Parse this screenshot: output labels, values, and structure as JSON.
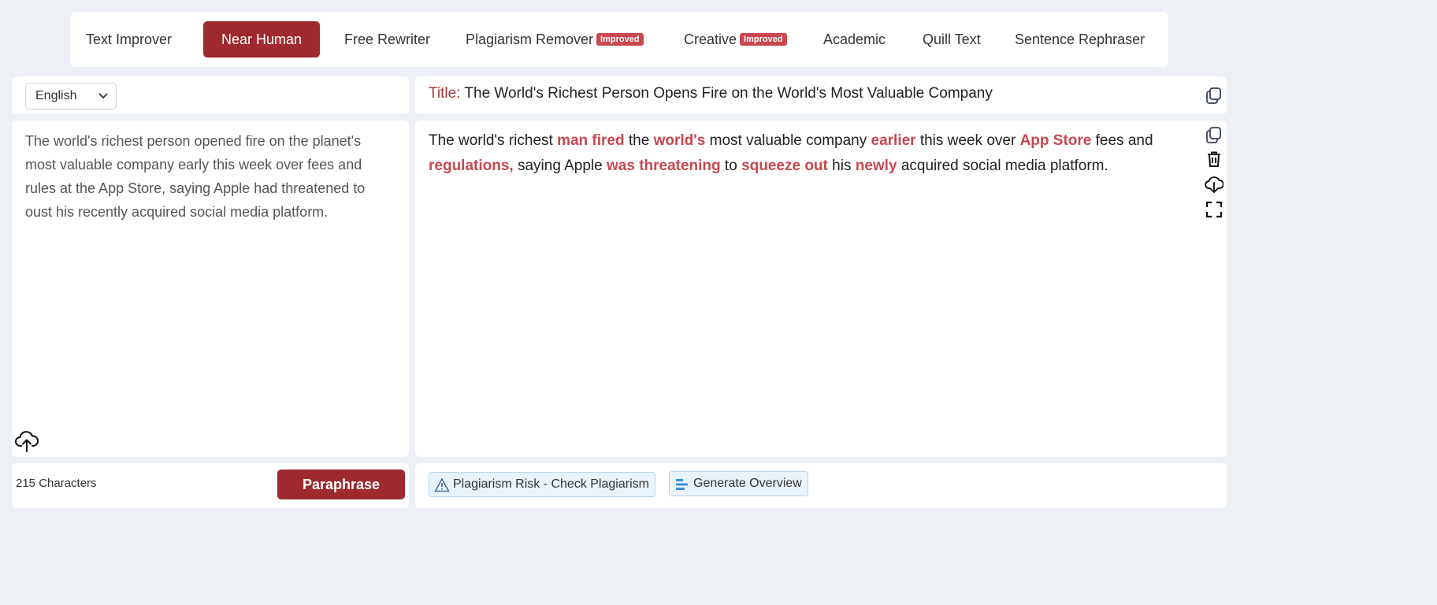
{
  "modes": [
    {
      "label": "Text Improver",
      "active": false
    },
    {
      "label": "Near Human",
      "active": true
    },
    {
      "label": "Free Rewriter",
      "active": false
    },
    {
      "label": "Plagiarism Remover",
      "active": false,
      "badge": "Improved"
    },
    {
      "label": "Creative",
      "active": false,
      "badge": "Improved"
    },
    {
      "label": "Academic",
      "active": false
    },
    {
      "label": "Quill Text",
      "active": false
    },
    {
      "label": "Sentence Rephraser",
      "active": false
    }
  ],
  "language": {
    "selected": "English"
  },
  "input": {
    "text": "The world's richest person opened fire on the planet's most valuable company early this week over fees and rules at the App Store, saying Apple had threatened to oust his recently acquired social media platform.",
    "char_count": "215 Characters",
    "paraphrase_label": "Paraphrase"
  },
  "output": {
    "title_label": "Title:",
    "title_text": "The World's Richest Person Opens Fire on the World's Most Valuable Company",
    "segments": [
      {
        "t": "The world's richest ",
        "hl": false
      },
      {
        "t": "man fired",
        "hl": true
      },
      {
        "t": " the ",
        "hl": false
      },
      {
        "t": "world's",
        "hl": true
      },
      {
        "t": " most valuable company ",
        "hl": false
      },
      {
        "t": "earlier",
        "hl": true
      },
      {
        "t": " this week over ",
        "hl": false
      },
      {
        "t": "App Store",
        "hl": true
      },
      {
        "t": " fees and ",
        "hl": false
      },
      {
        "t": "regulations,",
        "hl": true
      },
      {
        "t": " saying Apple ",
        "hl": false
      },
      {
        "t": "was threatening",
        "hl": true
      },
      {
        "t": " to ",
        "hl": false
      },
      {
        "t": "squeeze out",
        "hl": true
      },
      {
        "t": " his ",
        "hl": false
      },
      {
        "t": "newly",
        "hl": true
      },
      {
        "t": " acquired social media platform.",
        "hl": false
      }
    ],
    "plagiarism_label": "Plagiarism Risk - Check Plagiarism",
    "overview_label": "Generate Overview"
  },
  "colors": {
    "accent": "#9e2a2f",
    "highlight": "#c9474f",
    "background": "#edf1f5"
  },
  "icons": [
    "cloud-upload-icon",
    "copy-icon",
    "trash-icon",
    "cloud-download-icon",
    "fullscreen-icon",
    "warning-icon",
    "overview-icon",
    "chevron-down-icon"
  ]
}
